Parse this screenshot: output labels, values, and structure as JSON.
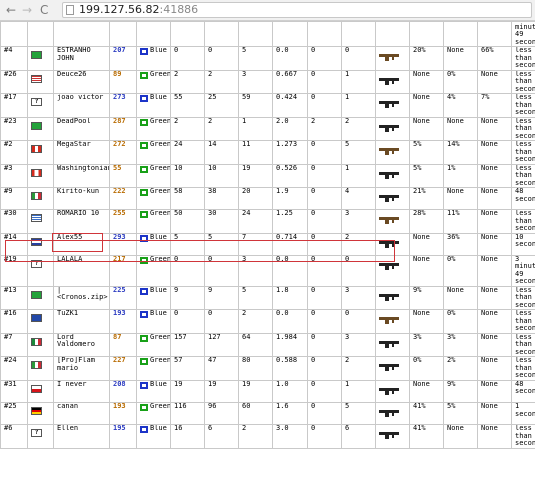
{
  "browser": {
    "url_host": "199.127.56.82",
    "url_port": ":41886",
    "back_glyph": "←",
    "forward_glyph": "→",
    "reload_glyph": "C"
  },
  "icons": {
    "team_icon": "helmet-icon",
    "weapon_icon": "rifle-icon",
    "unknown_flag": "?"
  },
  "colors": {
    "blue_team": "#1c34c8",
    "green_team": "#18a018",
    "highlight": "#d0353a",
    "score_orange": "#b86b00"
  },
  "partial_top_row": {
    "last": "minutes,\n49\nseconds"
  },
  "rows": [
    {
      "rank": "#4",
      "flag": "br",
      "name": "ESTRANHO JOHN",
      "score": "207",
      "team": "Blue",
      "c1": "0",
      "c2": "0",
      "c3": "5",
      "ratio": "0.0",
      "c5": "0",
      "c6": "0",
      "gun": "tan",
      "p1": "20%",
      "p2": "None",
      "p3": "66%",
      "last": "less\nthan a\nsecond"
    },
    {
      "rank": "#26",
      "flag": "us",
      "name": "Deuce26",
      "score": "89",
      "team": "Green",
      "c1": "2",
      "c2": "2",
      "c3": "3",
      "ratio": "0.667",
      "c5": "0",
      "c6": "1",
      "gun": "black",
      "p1": "None",
      "p2": "0%",
      "p3": "None",
      "last": "less\nthan a\nsecond"
    },
    {
      "rank": "#17",
      "flag": "unknown",
      "name": "joao victor",
      "score": "273",
      "team": "Blue",
      "c1": "55",
      "c2": "25",
      "c3": "59",
      "ratio": "0.424",
      "c5": "0",
      "c6": "1",
      "gun": "black",
      "p1": "None",
      "p2": "4%",
      "p3": "7%",
      "last": "less\nthan a\nsecond"
    },
    {
      "rank": "#23",
      "flag": "br",
      "name": "DeadPool",
      "score": "287",
      "team": "Green",
      "c1": "2",
      "c2": "2",
      "c3": "1",
      "ratio": "2.0",
      "c5": "2",
      "c6": "2",
      "gun": "black",
      "p1": "None",
      "p2": "None",
      "p3": "None",
      "last": "less\nthan a\nsecond"
    },
    {
      "rank": "#2",
      "flag": "pe",
      "name": "MegaStar",
      "score": "272",
      "team": "Green",
      "c1": "24",
      "c2": "14",
      "c3": "11",
      "ratio": "1.273",
      "c5": "0",
      "c6": "5",
      "gun": "tan",
      "p1": "5%",
      "p2": "14%",
      "p3": "None",
      "last": "less\nthan a\nsecond"
    },
    {
      "rank": "#3",
      "flag": "ca",
      "name": "Washingtonian",
      "score": "55",
      "team": "Green",
      "c1": "10",
      "c2": "10",
      "c3": "19",
      "ratio": "0.526",
      "c5": "0",
      "c6": "1",
      "gun": "black",
      "p1": "5%",
      "p2": "1%",
      "p3": "None",
      "last": "less\nthan a\nsecond"
    },
    {
      "rank": "#9",
      "flag": "it",
      "name": "Kirito-kun",
      "score": "222",
      "team": "Green",
      "c1": "58",
      "c2": "38",
      "c3": "20",
      "ratio": "1.9",
      "c5": "0",
      "c6": "4",
      "gun": "black",
      "p1": "21%",
      "p2": "None",
      "p3": "None",
      "last": "48\nseconds"
    },
    {
      "rank": "#30",
      "flag": "gr",
      "name": "ROMARIO 10",
      "score": "255",
      "team": "Green",
      "c1": "50",
      "c2": "30",
      "c3": "24",
      "ratio": "1.25",
      "c5": "0",
      "c6": "3",
      "gun": "tan",
      "p1": "28%",
      "p2": "11%",
      "p3": "None",
      "last": "less\nthan a\nsecond"
    },
    {
      "rank": "#14",
      "flag": "hn",
      "name": "Alex55",
      "score": "293",
      "team": "Blue",
      "c1": "5",
      "c2": "5",
      "c3": "7",
      "ratio": "0.714",
      "c5": "0",
      "c6": "2",
      "gun": "black",
      "p1": "None",
      "p2": "36%",
      "p3": "None",
      "last": "10\nseconds"
    },
    {
      "rank": "#19",
      "flag": "unknown",
      "name": "LALALA",
      "score": "217",
      "team": "Green",
      "c1": "0",
      "c2": "0",
      "c3": "3",
      "ratio": "0.0",
      "c5": "0",
      "c6": "0",
      "gun": "black",
      "p1": "None",
      "p2": "0%",
      "p3": "None",
      "last": "3\nminutes,\n49\nseconds"
    },
    {
      "rank": "#13",
      "flag": "br",
      "name": "|<Cronos.zip>|",
      "score": "225",
      "team": "Blue",
      "c1": "9",
      "c2": "9",
      "c3": "5",
      "ratio": "1.8",
      "c5": "0",
      "c6": "3",
      "gun": "black",
      "p1": "9%",
      "p2": "None",
      "p3": "None",
      "last": "less\nthan a\nsecond"
    },
    {
      "rank": "#16",
      "flag": "ba",
      "name": "TuZK1",
      "score": "193",
      "team": "Blue",
      "c1": "0",
      "c2": "0",
      "c3": "2",
      "ratio": "0.0",
      "c5": "0",
      "c6": "0",
      "gun": "tan",
      "p1": "None",
      "p2": "0%",
      "p3": "None",
      "last": "less\nthan a\nsecond"
    },
    {
      "rank": "#7",
      "flag": "mx",
      "name": "Lord Valdomero",
      "score": "87",
      "team": "Green",
      "c1": "157",
      "c2": "127",
      "c3": "64",
      "ratio": "1.984",
      "c5": "0",
      "c6": "3",
      "gun": "black",
      "p1": "3%",
      "p2": "3%",
      "p3": "None",
      "last": "less\nthan a\nsecond"
    },
    {
      "rank": "#24",
      "flag": "it",
      "name": "[Pro]Flam\nmario",
      "score": "227",
      "team": "Green",
      "c1": "57",
      "c2": "47",
      "c3": "80",
      "ratio": "0.588",
      "c5": "0",
      "c6": "2",
      "gun": "black",
      "p1": "0%",
      "p2": "2%",
      "p3": "None",
      "last": "less\nthan a\nsecond"
    },
    {
      "rank": "#31",
      "flag": "cz",
      "name": "I never",
      "score": "208",
      "team": "Blue",
      "c1": "19",
      "c2": "19",
      "c3": "19",
      "ratio": "1.0",
      "c5": "0",
      "c6": "1",
      "gun": "black",
      "p1": "None",
      "p2": "9%",
      "p3": "None",
      "last": "48\nseconds"
    },
    {
      "rank": "#25",
      "flag": "de",
      "name": "canan",
      "score": "193",
      "team": "Green",
      "c1": "116",
      "c2": "96",
      "c3": "60",
      "ratio": "1.6",
      "c5": "0",
      "c6": "5",
      "gun": "black",
      "p1": "41%",
      "p2": "5%",
      "p3": "None",
      "last": "1 second"
    },
    {
      "rank": "#6",
      "flag": "unknown",
      "name": "Ellen",
      "score": "195",
      "team": "Blue",
      "c1": "16",
      "c2": "6",
      "c3": "2",
      "ratio": "3.0",
      "c5": "0",
      "c6": "6",
      "gun": "black",
      "p1": "41%",
      "p2": "None",
      "p3": "None",
      "last": "less\nthan a\nsecond"
    }
  ]
}
